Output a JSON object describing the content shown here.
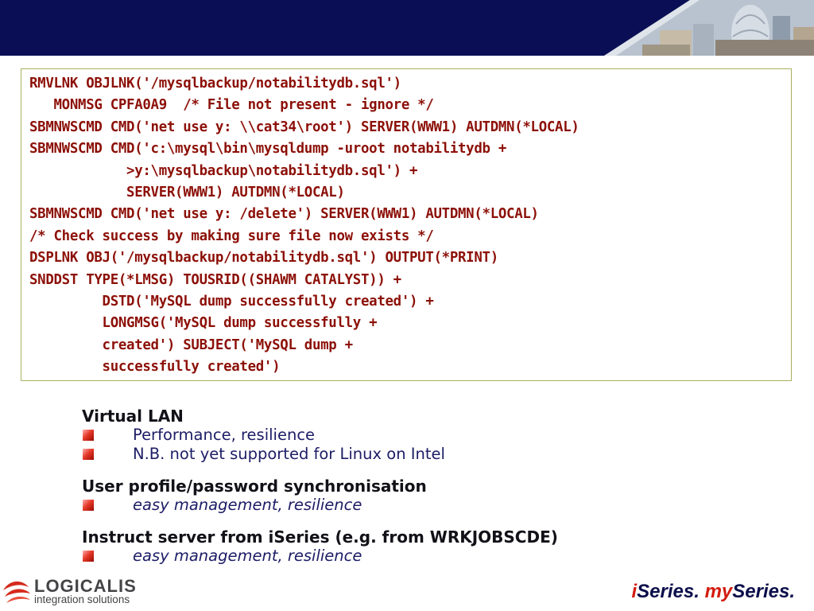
{
  "colors": {
    "banner_navy": "#0a0f55",
    "code_text": "#8c1008",
    "code_border": "#a8b060",
    "heading_text": "#111118",
    "bullet_text": "#1c1c66",
    "bullet_marker": "#e63a2a",
    "brand_red": "#d21c0f",
    "brand_navy": "#0b0e4a"
  },
  "code_lines": [
    "RMVLNK OBJLNK('/mysqlbackup/notabilitydb.sql')",
    "   MONMSG CPFA0A9  /* File not present - ignore */",
    "SBMNWSCMD CMD('net use y: \\\\cat34\\root') SERVER(WWW1) AUTDMN(*LOCAL)",
    "SBMNWSCMD CMD('c:\\mysql\\bin\\mysqldump -uroot notabilitydb +",
    "            >y:\\mysqlbackup\\notabilitydb.sql') +",
    "            SERVER(WWW1) AUTDMN(*LOCAL)",
    "SBMNWSCMD CMD('net use y: /delete') SERVER(WWW1) AUTDMN(*LOCAL)",
    "/* Check success by making sure file now exists */",
    "DSPLNK OBJ('/mysqlbackup/notabilitydb.sql') OUTPUT(*PRINT)",
    "SNDDST TYPE(*LMSG) TOUSRID((SHAWM CATALYST)) +",
    "         DSTD('MySQL dump successfully created') +",
    "         LONGMSG('MySQL dump successfully +",
    "         created') SUBJECT('MySQL dump +",
    "         successfully created')"
  ],
  "sections": [
    {
      "heading": "Virtual LAN",
      "items": [
        {
          "text": "Performance, resilience",
          "italic": false
        },
        {
          "text": "N.B. not yet supported for Linux on Intel",
          "italic": false
        }
      ]
    },
    {
      "heading": "User profile/password synchronisation",
      "items": [
        {
          "text": "easy management, resilience",
          "italic": true
        }
      ]
    },
    {
      "heading": "Instruct server from iSeries (e.g. from WRKJOBSCDE)",
      "items": [
        {
          "text": "easy management, resilience",
          "italic": true
        }
      ]
    }
  ],
  "footer": {
    "logo_name": "LOGICALIS",
    "logo_tagline": "integration solutions",
    "logo_icon": "logicalis-swoosh-icon",
    "brand": {
      "part1_prefix": "i",
      "part1_rest": "Series.",
      "part2_prefix": "my",
      "part2_rest": "Series."
    }
  },
  "header": {
    "banner_image": "city-skyline-photo"
  }
}
